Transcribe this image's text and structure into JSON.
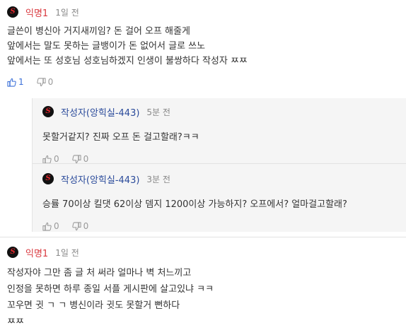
{
  "comments": [
    {
      "author": "익명1",
      "time": "1일 전",
      "text": "글쓴이 병신아 거지새끼임? 돈 걸어 오프 해줄게\n앞에서는 말도 못하는 글뱅이가 돈 없어서 글로 쓰노\n앞에서는 또 성호님 성호님하겠지 인생이 불쌍하다 작성자 ㅉㅉ",
      "likes": "1",
      "dislikes": "0",
      "replies": [
        {
          "author": "작성자(앙힉실-443)",
          "time": "5분 전",
          "text": "못할거같지? 진짜 오프 돈 걸고할래?ㅋㅋ",
          "likes": "0",
          "dislikes": "0"
        },
        {
          "author": "작성자(앙힉실-443)",
          "time": "3분 전",
          "text": "승률 70이상 킬댓 62이상 뎀지 1200이상 가능하지? 오프에서? 얼마걸고할래?",
          "likes": "0",
          "dislikes": "0"
        }
      ]
    },
    {
      "author": "익명1",
      "time": "1일 전",
      "text": "작성자야 그만 좀 글 처 써라 얼마나 벽 처느끼고\n인정을 못하면 하루 종일 서플 게시판에 살고있냐 ㅋㅋ\n꼬우면 귓 ㄱ ㄱ 병신이라 귓도 못할거 뻔하다\nㅉㅉ"
    }
  ],
  "avatar_glyph": "S",
  "colors": {
    "anon": "#d9383e",
    "author": "#2b4b9b",
    "like_active": "#3a6fd8"
  }
}
